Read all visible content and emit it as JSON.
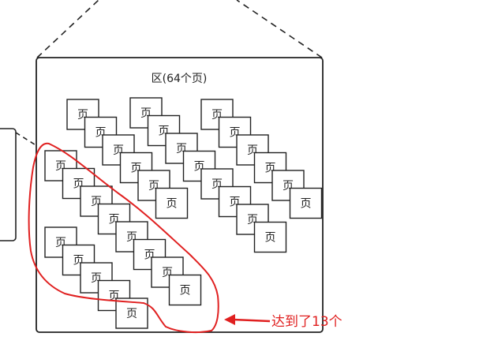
{
  "zone": {
    "title": "区(64个页)",
    "page_label": "页"
  },
  "annotation": {
    "text": "达到了13个",
    "color": "#e02020"
  },
  "colors": {
    "stroke": "#222222",
    "highlight": "#e02020"
  }
}
